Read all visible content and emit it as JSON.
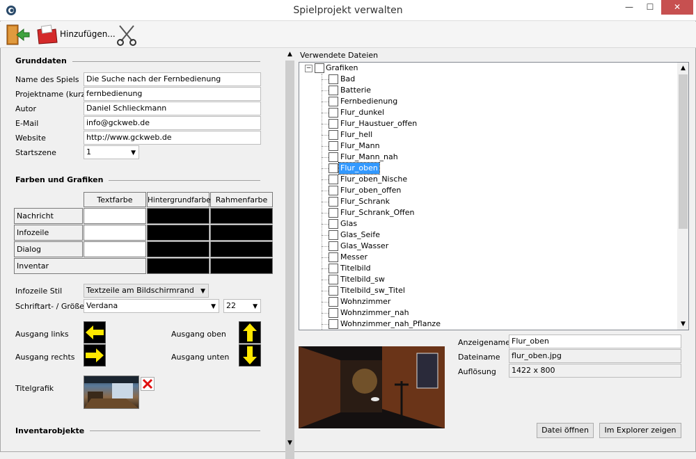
{
  "window": {
    "title": "Spielprojekt verwalten",
    "min": "—",
    "max": "☐",
    "close": "✕"
  },
  "toolbar": {
    "add_label": "Hinzufügen..."
  },
  "grunddaten": {
    "title": "Grunddaten",
    "fields": [
      {
        "label": "Name des Spiels",
        "value": "Die Suche nach der Fernbedienung"
      },
      {
        "label": "Projektname (kurz)",
        "value": "fernbedienung"
      },
      {
        "label": "Autor",
        "value": "Daniel Schlieckmann"
      },
      {
        "label": "E-Mail",
        "value": "info@gckweb.de"
      },
      {
        "label": "Website",
        "value": "http://www.gckweb.de"
      }
    ],
    "startszene_label": "Startszene",
    "startszene_value": "1"
  },
  "farben": {
    "title": "Farben und Grafiken",
    "headers": [
      "Textfarbe",
      "Hintergrundfarbe",
      "Rahmenfarbe"
    ],
    "rows": [
      "Nachricht",
      "Infozeile",
      "Dialog",
      "Inventar"
    ],
    "white": "#ffffff",
    "black": "#000000"
  },
  "stil": {
    "infozeile_label": "Infozeile Stil",
    "infozeile_value": "Textzeile am Bildschirmrand",
    "schrift_label": "Schriftart- / Größe",
    "schrift_value": "Verdana",
    "groesse_value": "22"
  },
  "ausgaenge": {
    "links": "Ausgang links",
    "rechts": "Ausgang rechts",
    "oben": "Ausgang oben",
    "unten": "Ausgang unten"
  },
  "titelgrafik_label": "Titelgrafik",
  "inventar_title": "Inventarobjekte",
  "files": {
    "title": "Verwendete Dateien",
    "root": "Grafiken",
    "items": [
      "Bad",
      "Batterie",
      "Fernbedienung",
      "Flur_dunkel",
      "Flur_Haustuer_offen",
      "Flur_hell",
      "Flur_Mann",
      "Flur_Mann_nah",
      "Flur_oben",
      "Flur_oben_Nische",
      "Flur_oben_offen",
      "Flur_Schrank",
      "Flur_Schrank_Offen",
      "Glas",
      "Glas_Seife",
      "Glas_Wasser",
      "Messer",
      "Titelbild",
      "Titelbild_sw",
      "Titelbild_sw_Titel",
      "Wohnzimmer",
      "Wohnzimmer_nah",
      "Wohnzimmer_nah_Pflanze"
    ],
    "selected": "Flur_oben",
    "selection_color": "#3399ff"
  },
  "details": {
    "anzeigename_label": "Anzeigename",
    "anzeigename_value": "Flur_oben",
    "dateiname_label": "Dateiname",
    "dateiname_value": "flur_oben.jpg",
    "aufloesung_label": "Auflösung",
    "aufloesung_value": "1422 x 800",
    "open_button": "Datei öffnen",
    "explorer_button": "Im Explorer zeigen"
  }
}
